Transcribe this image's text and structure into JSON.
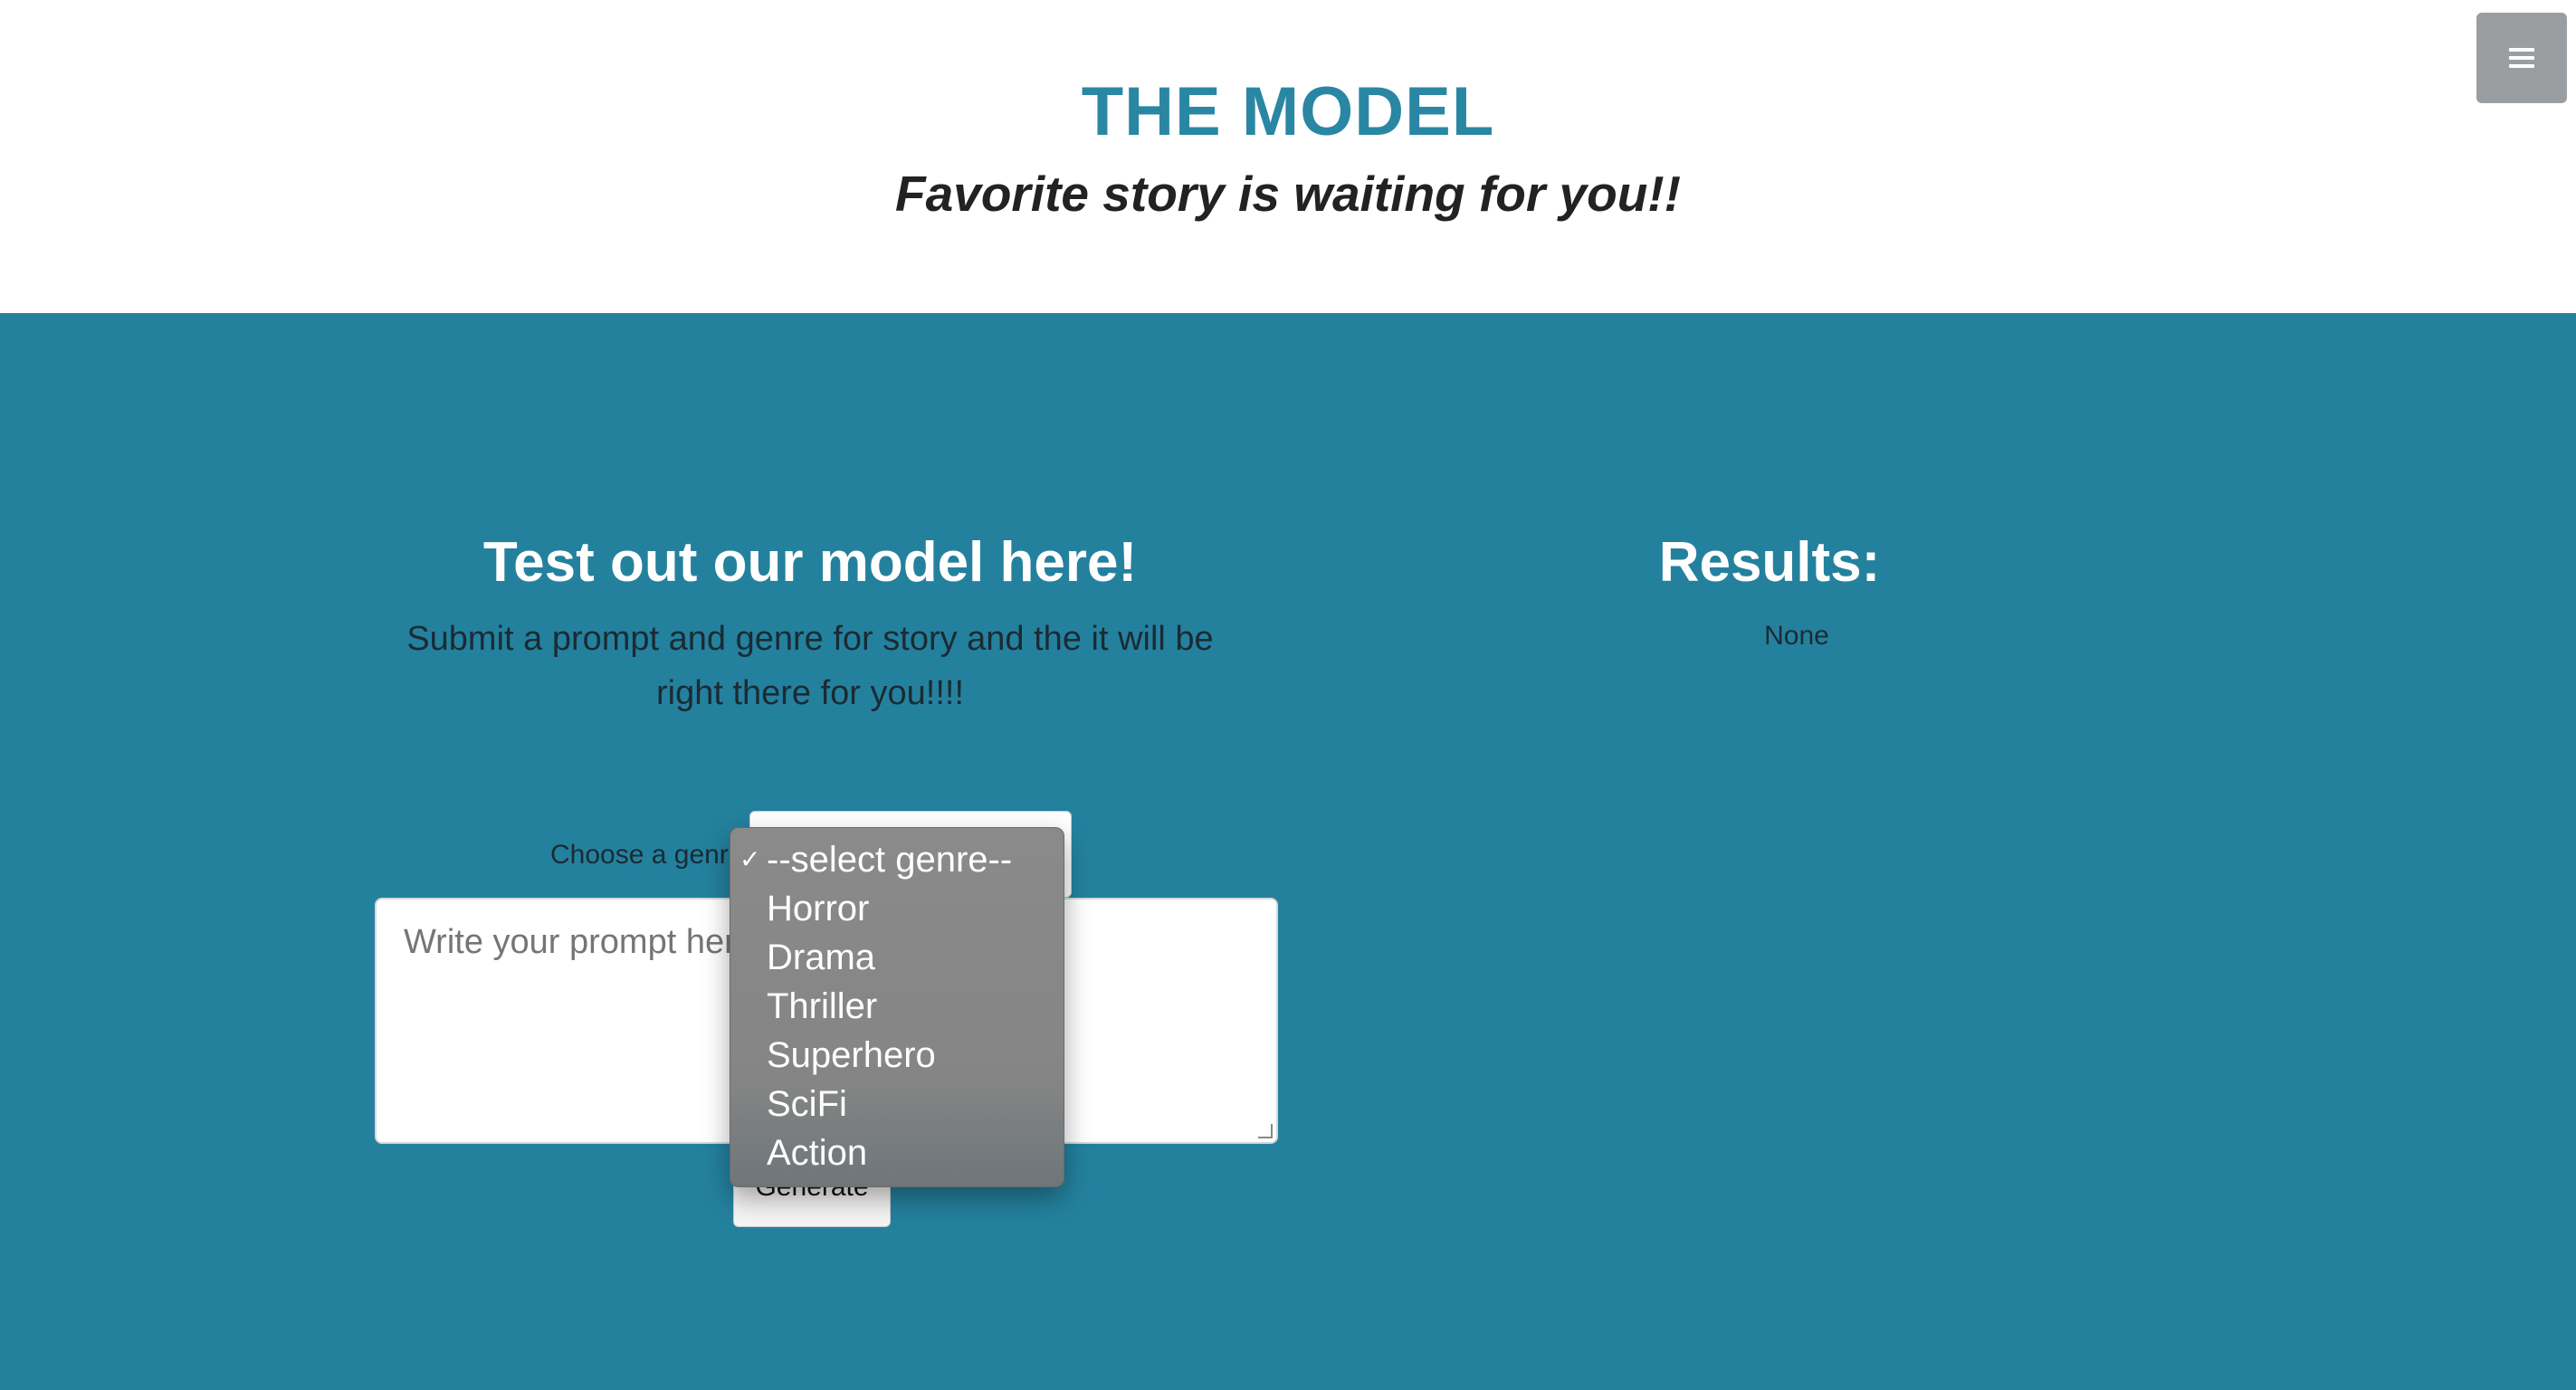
{
  "header": {
    "brand": "THE MODEL",
    "tagline": "Favorite story is waiting for you!!",
    "menu_icon": "hamburger-menu-icon"
  },
  "form": {
    "title": "Test out our model here!",
    "subtitle": "Submit a prompt and genre for story and the it will be right there for you!!!!",
    "genre_label": "Choose a genre",
    "genre_selected": "--select genre--",
    "genre_options": [
      "--select genre--",
      "Horror",
      "Drama",
      "Thriller",
      "Superhero",
      "SciFi",
      "Action"
    ],
    "prompt_placeholder": "Write your prompt here",
    "generate_label": "Generate"
  },
  "results": {
    "title": "Results:",
    "value": "None"
  },
  "colors": {
    "brand": "#2a87a3",
    "section_bg": "#24819e",
    "menu_button": "#9a9ea1"
  }
}
